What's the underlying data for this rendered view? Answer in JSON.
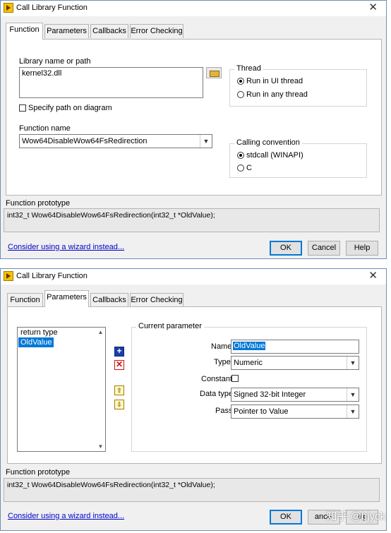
{
  "dialog1": {
    "title": "Call Library Function",
    "close_icon": "close-icon",
    "tabs": [
      {
        "label": "Function",
        "active": true
      },
      {
        "label": "Parameters",
        "active": false
      },
      {
        "label": "Callbacks",
        "active": false
      },
      {
        "label": "Error Checking",
        "active": false
      }
    ],
    "library_label": "Library name or path",
    "library_value": "kernel32.dll",
    "specify_path_label": "Specify path on diagram",
    "function_name_label": "Function name",
    "function_name_value": "Wow64DisableWow64FsRedirection",
    "thread": {
      "title": "Thread",
      "options": [
        {
          "label": "Run in UI thread",
          "selected": true
        },
        {
          "label": "Run in any thread",
          "selected": false
        }
      ]
    },
    "calling_convention": {
      "title": "Calling convention",
      "options": [
        {
          "label": "stdcall (WINAPI)",
          "selected": true
        },
        {
          "label": "C",
          "selected": false
        }
      ]
    },
    "prototype_label": "Function prototype",
    "prototype_value": "int32_t Wow64DisableWow64FsRedirection(int32_t *OldValue);",
    "wizard_link": "Consider using a wizard instead...",
    "ok_label": "OK",
    "cancel_label": "Cancel",
    "help_label": "Help"
  },
  "dialog2": {
    "title": "Call Library Function",
    "tabs": [
      {
        "label": "Function",
        "active": false
      },
      {
        "label": "Parameters",
        "active": true
      },
      {
        "label": "Callbacks",
        "active": false
      },
      {
        "label": "Error Checking",
        "active": false
      }
    ],
    "param_list": [
      {
        "label": "return type",
        "selected": false
      },
      {
        "label": "OldValue",
        "selected": true
      }
    ],
    "current_parameter": {
      "title": "Current parameter",
      "name_label": "Name",
      "name_value": "OldValue",
      "type_label": "Type",
      "type_value": "Numeric",
      "constant_label": "Constant",
      "data_type_label": "Data type",
      "data_type_value": "Signed 32-bit Integer",
      "pass_label": "Pass",
      "pass_value": "Pointer to Value"
    },
    "prototype_label": "Function prototype",
    "prototype_value": "int32_t Wow64DisableWow64FsRedirection(int32_t *OldValue);",
    "wizard_link": "Consider using a wizard instead...",
    "ok_label": "OK",
    "cancel_label": "ancel",
    "help_label": "elp"
  },
  "watermark": "知乎 @bjyck"
}
